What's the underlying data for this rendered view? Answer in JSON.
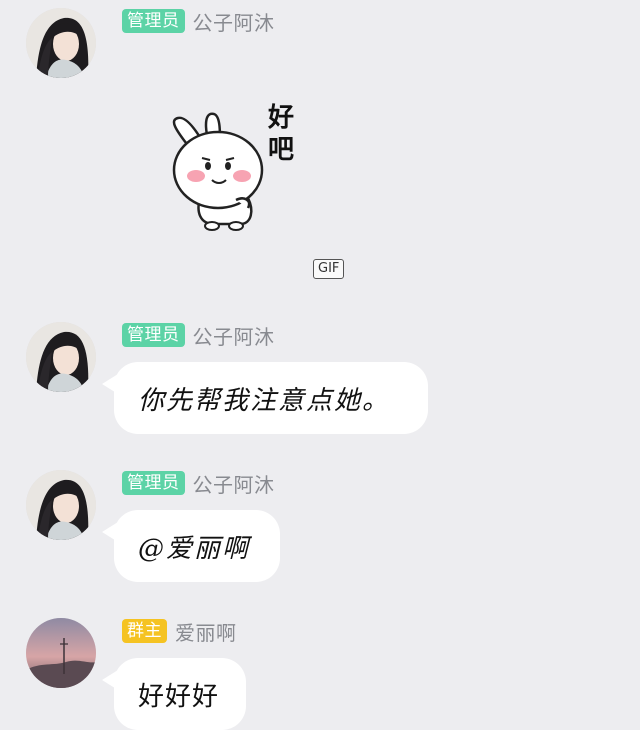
{
  "messages": [
    {
      "role_badge": "管理员",
      "nickname": "公子阿沐",
      "sticker_text": "好吧",
      "gif_label": "GIF"
    },
    {
      "role_badge": "管理员",
      "nickname": "公子阿沐",
      "text": "你先帮我注意点她。"
    },
    {
      "role_badge": "管理员",
      "nickname": "公子阿沐",
      "text": "@爱丽啊"
    },
    {
      "role_badge": "群主",
      "nickname": "爱丽啊",
      "text": "好好好"
    }
  ],
  "colors": {
    "background": "#ededf0",
    "admin_badge": "#5cd3a6",
    "owner_badge": "#f5c322",
    "bubble": "#ffffff",
    "nickname": "#888a90"
  },
  "icons": {
    "admin_avatar": "avatar-illustrated-man-long-hair",
    "owner_avatar": "avatar-sunset-landscape",
    "sticker": "white-rabbit-sticker"
  }
}
